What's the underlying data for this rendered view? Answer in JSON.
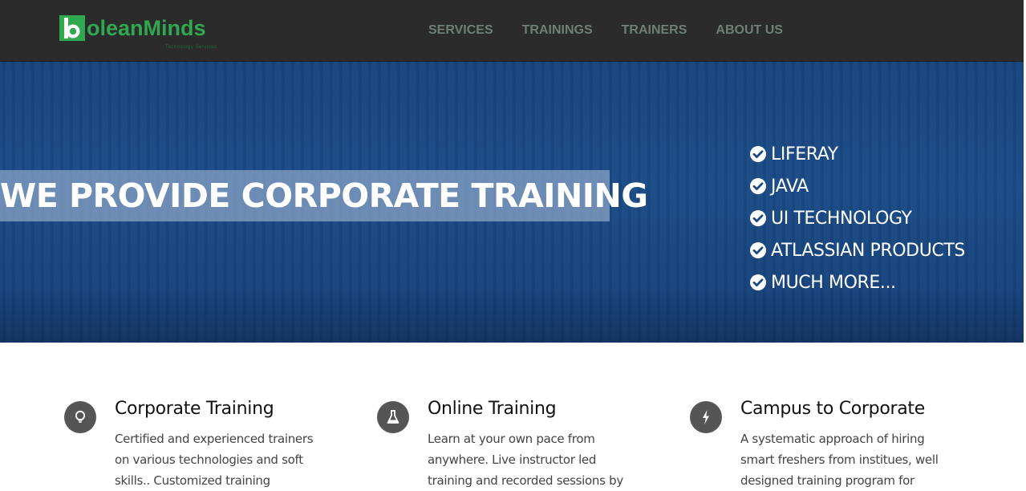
{
  "brand": {
    "name": "oleanMinds",
    "logo_mark": "b",
    "tagline": "Technology Services",
    "color": "#2fa84f"
  },
  "nav": {
    "items": [
      {
        "label": "SERVICES"
      },
      {
        "label": "TRAININGS"
      },
      {
        "label": "TRAINERS"
      },
      {
        "label": "ABOUT US"
      }
    ]
  },
  "hero": {
    "headline": "WE PROVIDE CORPORATE TRAINING",
    "technologies": [
      {
        "label": "LIFERAY",
        "icon": "check-circle-icon"
      },
      {
        "label": "JAVA",
        "icon": "check-circle-icon"
      },
      {
        "label": "UI TECHNOLOGY",
        "icon": "check-circle-icon"
      },
      {
        "label": "ATLASSIAN PRODUCTS",
        "icon": "check-circle-icon"
      },
      {
        "label": "MUCH MORE...",
        "icon": "check-circle-icon"
      }
    ],
    "background_color": "#1a4a86"
  },
  "features": [
    {
      "icon": "lightbulb-icon",
      "title": "Corporate Training",
      "description": "Certified and experienced trainers on various technologies and soft skills.. Customized training"
    },
    {
      "icon": "flask-icon",
      "title": "Online Training",
      "description": "Learn at your own pace from anywhere. Live instructor led training and recorded sessions by"
    },
    {
      "icon": "lightning-bolt-icon",
      "title": "Campus to Corporate",
      "description": "A systematic approach of hiring smart freshers from institues, well designed training program for"
    }
  ]
}
